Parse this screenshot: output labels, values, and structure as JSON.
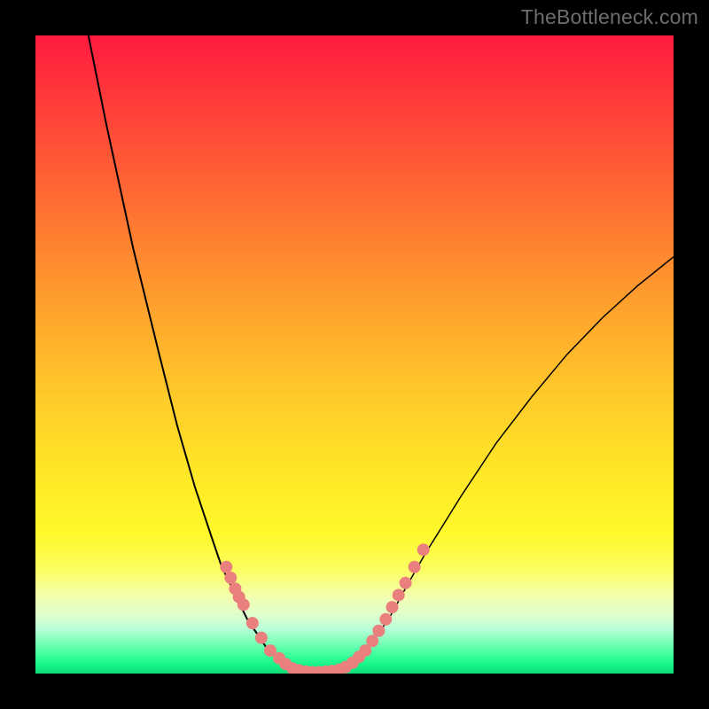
{
  "watermark": "TheBottleneck.com",
  "colors": {
    "background_frame": "#000000",
    "gradient_top": "#ff1a3f",
    "gradient_bottom": "#0edb78",
    "curve_stroke": "#000000",
    "dot_fill": "#e9807e"
  },
  "chart_data": {
    "type": "line",
    "title": "",
    "xlabel": "",
    "ylabel": "",
    "xlim": [
      0,
      100
    ],
    "ylim": [
      0,
      100
    ],
    "note": "Axes are unlabeled; values are normalized 0–100 estimated from pixel positions within the 720×720 plot area. y=0 is bottom, x=0 is left.",
    "series": [
      {
        "name": "left-branch",
        "x": [
          8.3,
          11.1,
          15.3,
          19.4,
          22.2,
          25.0,
          27.8,
          29.2,
          30.6,
          31.9,
          33.3,
          34.7,
          36.1,
          37.5,
          38.9,
          40.3
        ],
        "y": [
          100.0,
          86.1,
          66.7,
          50.0,
          38.9,
          29.2,
          20.8,
          16.7,
          13.9,
          11.1,
          8.3,
          6.3,
          4.2,
          2.8,
          1.4,
          0.7
        ]
      },
      {
        "name": "valley-floor",
        "x": [
          40.3,
          41.7,
          43.1,
          44.4,
          45.8,
          47.2,
          48.6
        ],
        "y": [
          0.7,
          0.3,
          0.1,
          0.1,
          0.1,
          0.3,
          0.7
        ]
      },
      {
        "name": "right-branch",
        "x": [
          48.6,
          50.0,
          51.4,
          52.8,
          54.2,
          55.6,
          58.3,
          61.1,
          66.7,
          72.2,
          77.8,
          83.3,
          88.9,
          94.4,
          100.0
        ],
        "y": [
          0.7,
          1.7,
          3.1,
          4.9,
          6.9,
          9.0,
          13.9,
          18.8,
          27.8,
          36.1,
          43.4,
          50.0,
          55.8,
          60.8,
          65.3
        ]
      }
    ],
    "dots": {
      "name": "highlight-dots",
      "note": "Salmon dots overlay the curve near the valley and lower slopes.",
      "points": [
        {
          "x": 29.9,
          "y": 16.7
        },
        {
          "x": 30.6,
          "y": 15.0
        },
        {
          "x": 31.3,
          "y": 13.3
        },
        {
          "x": 31.9,
          "y": 12.0
        },
        {
          "x": 32.6,
          "y": 10.8
        },
        {
          "x": 34.0,
          "y": 7.9
        },
        {
          "x": 35.4,
          "y": 5.6
        },
        {
          "x": 36.8,
          "y": 3.6
        },
        {
          "x": 38.2,
          "y": 2.4
        },
        {
          "x": 39.2,
          "y": 1.5
        },
        {
          "x": 40.3,
          "y": 0.8
        },
        {
          "x": 41.3,
          "y": 0.5
        },
        {
          "x": 42.4,
          "y": 0.3
        },
        {
          "x": 43.4,
          "y": 0.2
        },
        {
          "x": 44.4,
          "y": 0.2
        },
        {
          "x": 45.5,
          "y": 0.3
        },
        {
          "x": 46.5,
          "y": 0.4
        },
        {
          "x": 47.6,
          "y": 0.6
        },
        {
          "x": 48.6,
          "y": 1.0
        },
        {
          "x": 49.7,
          "y": 1.7
        },
        {
          "x": 50.7,
          "y": 2.6
        },
        {
          "x": 51.7,
          "y": 3.6
        },
        {
          "x": 52.8,
          "y": 5.1
        },
        {
          "x": 53.8,
          "y": 6.7
        },
        {
          "x": 54.9,
          "y": 8.5
        },
        {
          "x": 55.9,
          "y": 10.4
        },
        {
          "x": 56.9,
          "y": 12.3
        },
        {
          "x": 58.0,
          "y": 14.2
        },
        {
          "x": 59.4,
          "y": 16.7
        },
        {
          "x": 60.8,
          "y": 19.4
        }
      ]
    }
  }
}
